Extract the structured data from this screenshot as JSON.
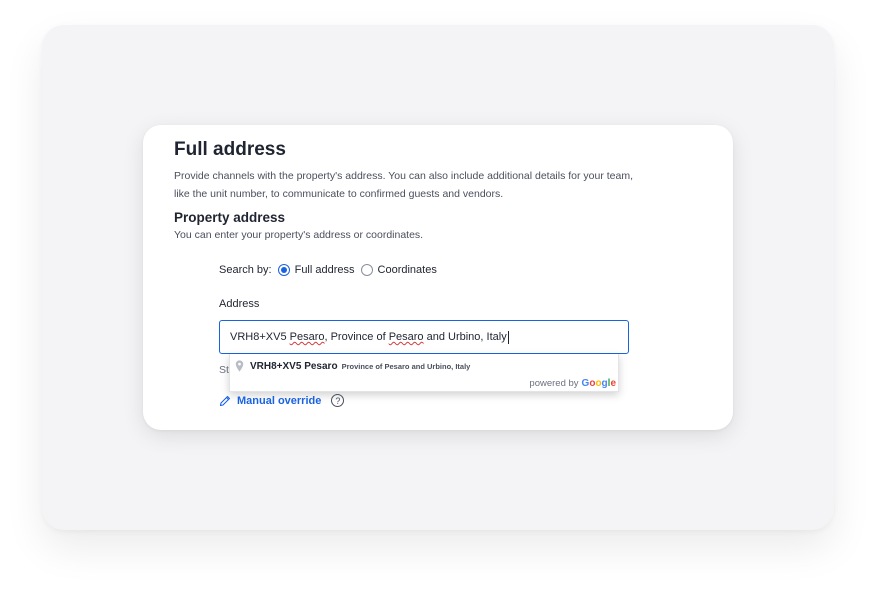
{
  "section": {
    "title": "Full address",
    "description": "Provide channels with the property's address. You can also include additional details for your team, like the unit number, to communicate to confirmed guests and vendors."
  },
  "property_address": {
    "title": "Property address",
    "description": "You can enter your property's address or coordinates."
  },
  "search_by": {
    "label": "Search by:",
    "options": [
      {
        "label": "Full address",
        "selected": true
      },
      {
        "label": "Coordinates",
        "selected": false
      }
    ]
  },
  "address": {
    "label": "Address",
    "value_parts": [
      "VRH8+XV5 ",
      "Pesaro",
      ", Province of ",
      "Pesaro",
      " and Urbino, Italy"
    ],
    "hint_visible": "St"
  },
  "autocomplete": {
    "main_text": "VRH8+XV5 Pesaro",
    "secondary_text": "Province of Pesaro and Urbino, Italy",
    "powered_by": "powered by",
    "logo_letters": [
      "G",
      "o",
      "o",
      "g",
      "l",
      "e"
    ],
    "icon": "map-pin-icon"
  },
  "override": {
    "label": "Manual override",
    "help_symbol": "?"
  },
  "colors": {
    "accent": "#1a63e0",
    "outer_background": "#f4f4f6"
  }
}
